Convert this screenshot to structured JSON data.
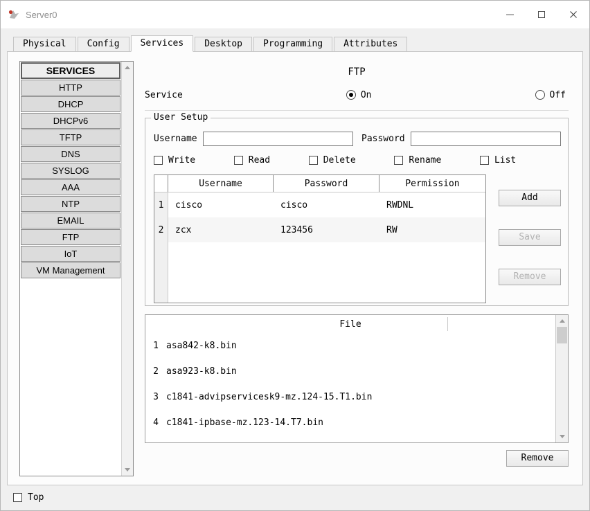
{
  "window": {
    "title": "Server0"
  },
  "tabs": [
    {
      "label": "Physical",
      "active": false
    },
    {
      "label": "Config",
      "active": false
    },
    {
      "label": "Services",
      "active": true
    },
    {
      "label": "Desktop",
      "active": false
    },
    {
      "label": "Programming",
      "active": false
    },
    {
      "label": "Attributes",
      "active": false
    }
  ],
  "sidebar": {
    "header": "SERVICES",
    "items": [
      "HTTP",
      "DHCP",
      "DHCPv6",
      "TFTP",
      "DNS",
      "SYSLOG",
      "AAA",
      "NTP",
      "EMAIL",
      "FTP",
      "IoT",
      "VM Management"
    ]
  },
  "main": {
    "title": "FTP",
    "service": {
      "label": "Service",
      "on_label": "On",
      "off_label": "Off",
      "selected": "On"
    },
    "user_setup": {
      "legend": "User Setup",
      "username_label": "Username",
      "password_label": "Password",
      "username_value": "",
      "password_value": "",
      "checkboxes": [
        "Write",
        "Read",
        "Delete",
        "Rename",
        "List"
      ],
      "table": {
        "headers": [
          "Username",
          "Password",
          "Permission"
        ],
        "rows": [
          {
            "num": "1",
            "username": "cisco",
            "password": "cisco",
            "permission": "RWDNL"
          },
          {
            "num": "2",
            "username": "zcx",
            "password": "123456",
            "permission": "RW"
          }
        ]
      },
      "buttons": {
        "add": "Add",
        "save": "Save",
        "remove": "Remove"
      }
    },
    "file_table": {
      "header": "File",
      "rows": [
        {
          "num": "1",
          "file": "asa842-k8.bin"
        },
        {
          "num": "2",
          "file": "asa923-k8.bin"
        },
        {
          "num": "3",
          "file": "c1841-advipservicesk9-mz.124-15.T1.bin"
        },
        {
          "num": "4",
          "file": "c1841-ipbase-mz.123-14.T7.bin"
        }
      ]
    },
    "remove_button": "Remove"
  },
  "footer": {
    "top_label": "Top"
  },
  "colors": {
    "window_background": "#f0f0f0",
    "panel_background": "#fcfcfc",
    "button_face": "#dcdcdc"
  }
}
